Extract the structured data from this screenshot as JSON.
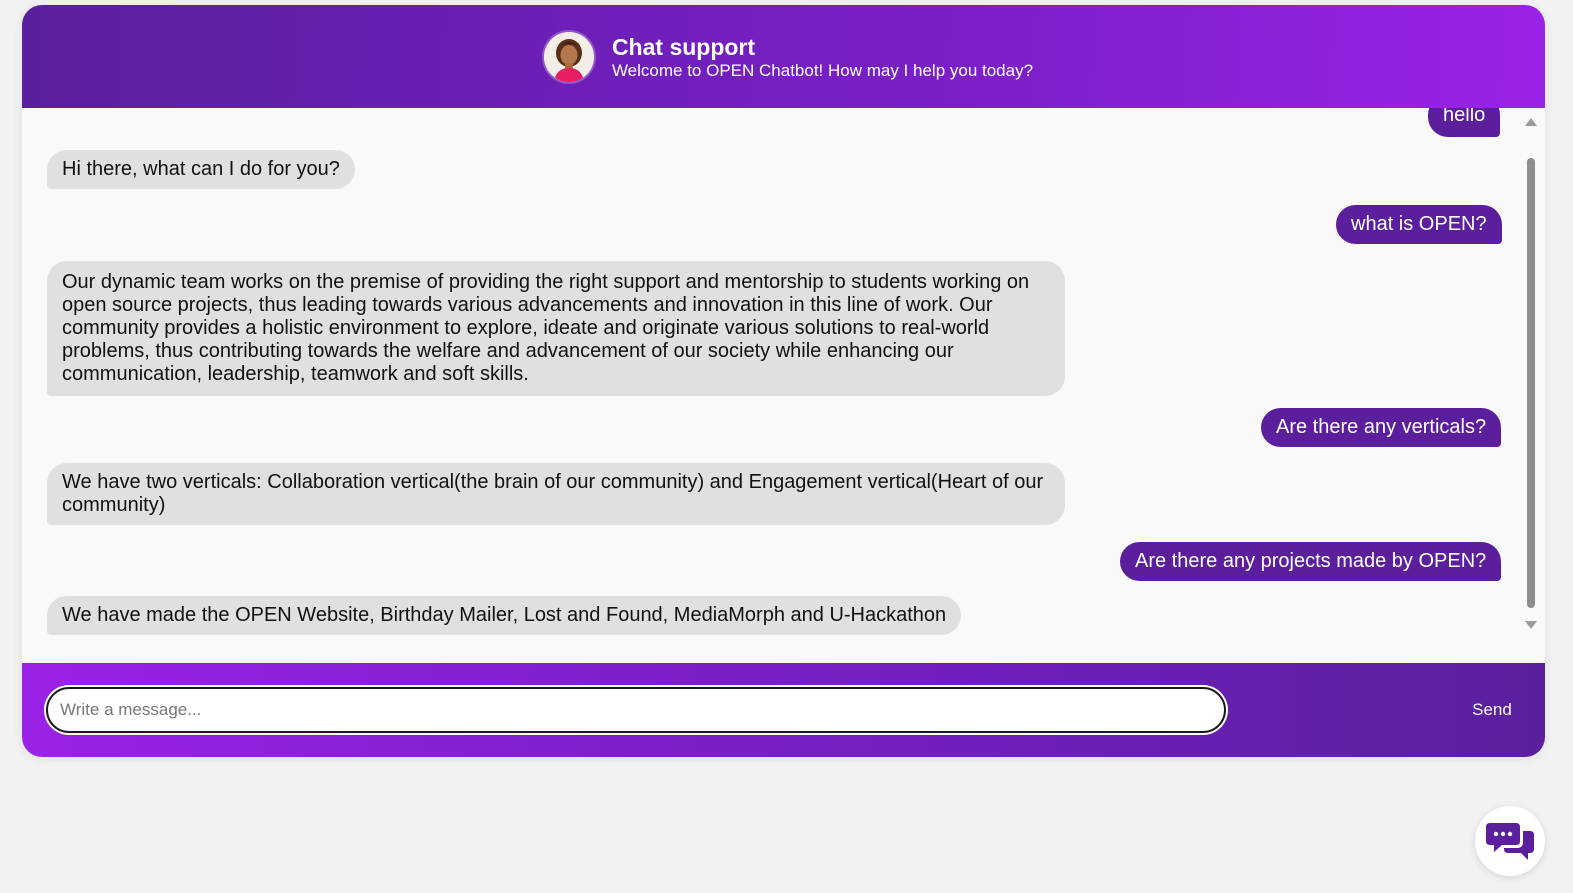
{
  "header": {
    "title": "Chat support",
    "subtitle": "Welcome to OPEN Chatbot! How may I help you today?"
  },
  "messages": [
    {
      "sender": "user",
      "text": "hello"
    },
    {
      "sender": "bot",
      "text": "Hi there, what can I do for you?"
    },
    {
      "sender": "user",
      "text": "what is OPEN?"
    },
    {
      "sender": "bot",
      "text": "Our dynamic team works on the premise of providing the right support and mentorship to students working on open source projects, thus leading towards various advancements and innovation in this line of work. Our community provides a holistic environment to explore, ideate and originate various solutions to real-world problems, thus contributing towards the welfare and advancement of our society while enhancing our communication, leadership, teamwork and soft skills."
    },
    {
      "sender": "user",
      "text": "Are there any verticals?"
    },
    {
      "sender": "bot",
      "text": "We have two verticals: Collaboration vertical(the brain of our community) and Engagement vertical(Heart of our community)"
    },
    {
      "sender": "user",
      "text": "Are there any projects made by OPEN?"
    },
    {
      "sender": "bot",
      "text": "We have made the OPEN Website, Birthday Mailer, Lost and Found, MediaMorph and U-Hackathon"
    }
  ],
  "composer": {
    "placeholder": "Write a message...",
    "send_label": "Send"
  },
  "icons": {
    "avatar": "support-agent-avatar",
    "launcher": "chat-bubbles-icon"
  },
  "colors": {
    "header_gradient_start": "#5a1f9e",
    "header_gradient_end": "#9b22e6",
    "user_bubble": "#5b1f9e",
    "bot_bubble": "#e0e0e0",
    "launcher_icon": "#5b1f9e"
  }
}
